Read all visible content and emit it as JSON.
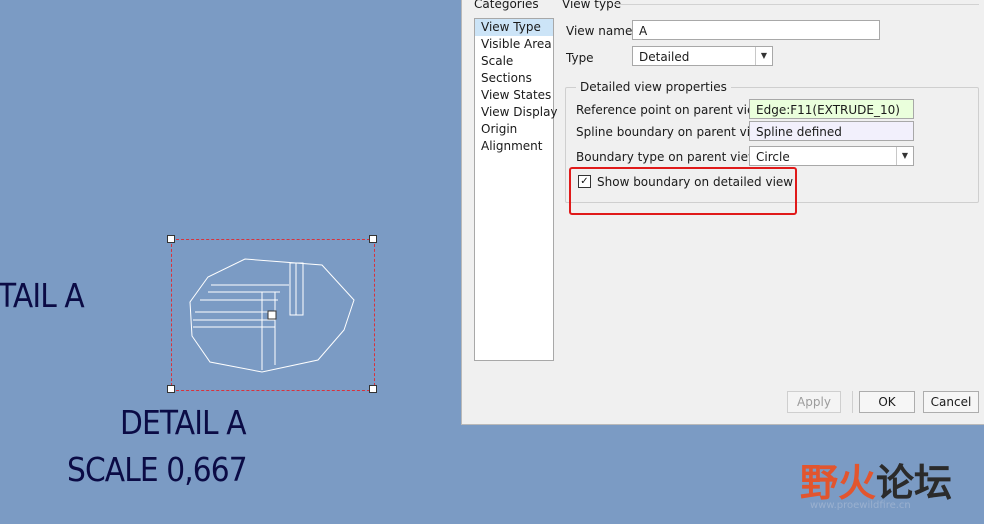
{
  "canvas": {
    "detail_partial": "TAIL A",
    "detail_label": "DETAIL A",
    "scale_label": "SCALE 0,667"
  },
  "dialog": {
    "categories_label": "Categories",
    "view_type_label": "View type",
    "categories": [
      "View Type",
      "Visible Area",
      "Scale",
      "Sections",
      "View States",
      "View Display",
      "Origin",
      "Alignment"
    ],
    "selected_category": "View Type",
    "view_name_label": "View name",
    "view_name_value": "A",
    "type_label": "Type",
    "type_value": "Detailed",
    "detailed_props_title": "Detailed view properties",
    "ref_point_label": "Reference point on parent view",
    "ref_point_value": "Edge:F11(EXTRUDE_10)",
    "spline_label": "Spline boundary on parent view",
    "spline_value": "Spline defined",
    "boundary_type_label": "Boundary type on parent view",
    "boundary_type_value": "Circle",
    "show_boundary_label": "Show boundary on detailed view",
    "show_boundary_checked": "✓",
    "buttons": {
      "apply": "Apply",
      "ok": "OK",
      "cancel": "Cancel"
    }
  },
  "watermark": {
    "part1": "野火",
    "part2": "论坛",
    "url": "www.proewildfire.cn"
  },
  "colors": {
    "canvas_bg": "#7b9bc4",
    "cad_text": "#0b0b45",
    "selection_dash": "#d8323c",
    "highlight_red": "#e01a1a",
    "list_selection": "#cce4f7"
  }
}
